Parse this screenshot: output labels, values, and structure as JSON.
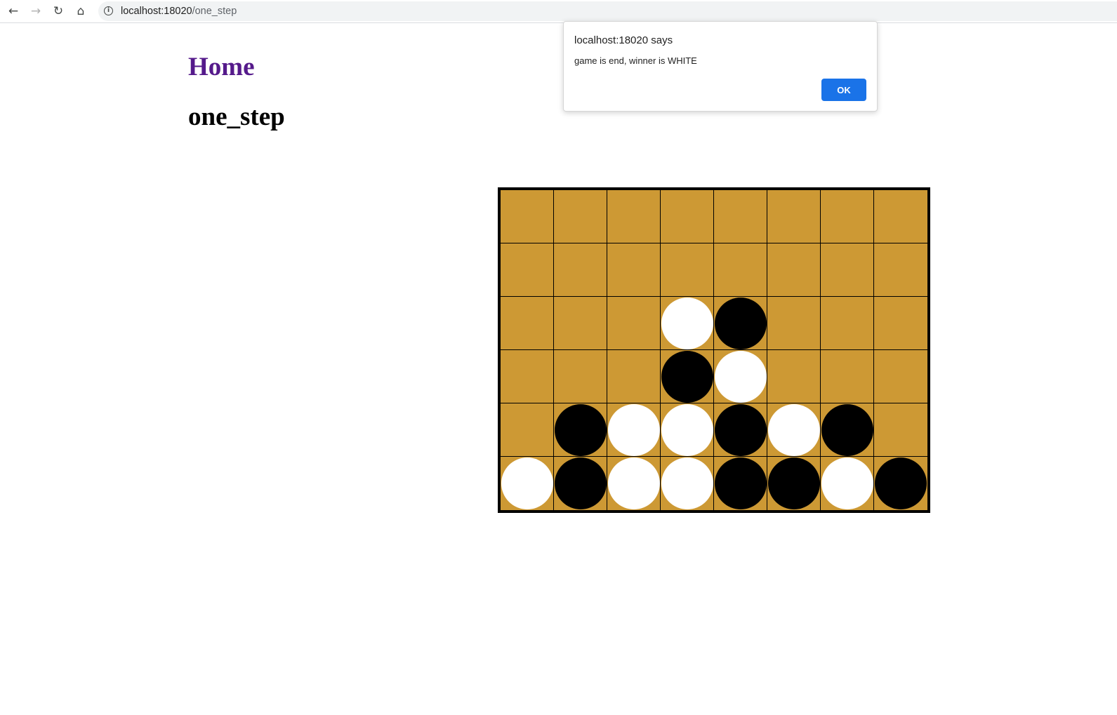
{
  "browser": {
    "back_icon": "←",
    "forward_icon": "→",
    "reload_icon": "↻",
    "home_icon": "⌂",
    "info_icon": "i",
    "url_host": "localhost:18020",
    "url_path": "/one_step"
  },
  "page": {
    "home_link": "Home",
    "title": "one_step"
  },
  "board": {
    "rows": 6,
    "cols": 8,
    "board_color": "#cd9934",
    "cells": [
      [
        "",
        "",
        "",
        "",
        "",
        "",
        "",
        ""
      ],
      [
        "",
        "",
        "",
        "",
        "",
        "",
        "",
        ""
      ],
      [
        "",
        "",
        "",
        "W",
        "B",
        "",
        "",
        ""
      ],
      [
        "",
        "",
        "",
        "B",
        "W",
        "",
        "",
        ""
      ],
      [
        "",
        "B",
        "W",
        "W",
        "B",
        "W",
        "B",
        ""
      ],
      [
        "W",
        "B",
        "W",
        "W",
        "B",
        "B",
        "W",
        "B"
      ]
    ]
  },
  "dialog": {
    "title": "localhost:18020 says",
    "message": "game is end, winner is WHITE",
    "ok_label": "OK",
    "ok_color": "#1a73e8"
  }
}
